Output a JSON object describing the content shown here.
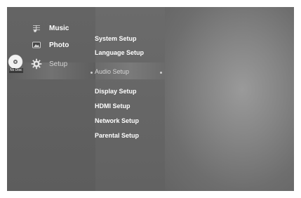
{
  "main_menu": [
    {
      "label": "Music",
      "icon": "music-icon",
      "selected": false
    },
    {
      "label": "Photo",
      "icon": "photo-icon",
      "selected": false
    },
    {
      "label": "Setup",
      "icon": "gear-icon",
      "selected": true
    }
  ],
  "disc_status": "No Disc",
  "setup_menu": [
    {
      "label": "System Setup",
      "selected": false
    },
    {
      "label": "Language Setup",
      "selected": false
    },
    {
      "label": "Audio Setup",
      "selected": true
    },
    {
      "label": "Display Setup",
      "selected": false
    },
    {
      "label": "HDMI Setup",
      "selected": false
    },
    {
      "label": "Network Setup",
      "selected": false
    },
    {
      "label": "Parental Setup",
      "selected": false
    }
  ]
}
